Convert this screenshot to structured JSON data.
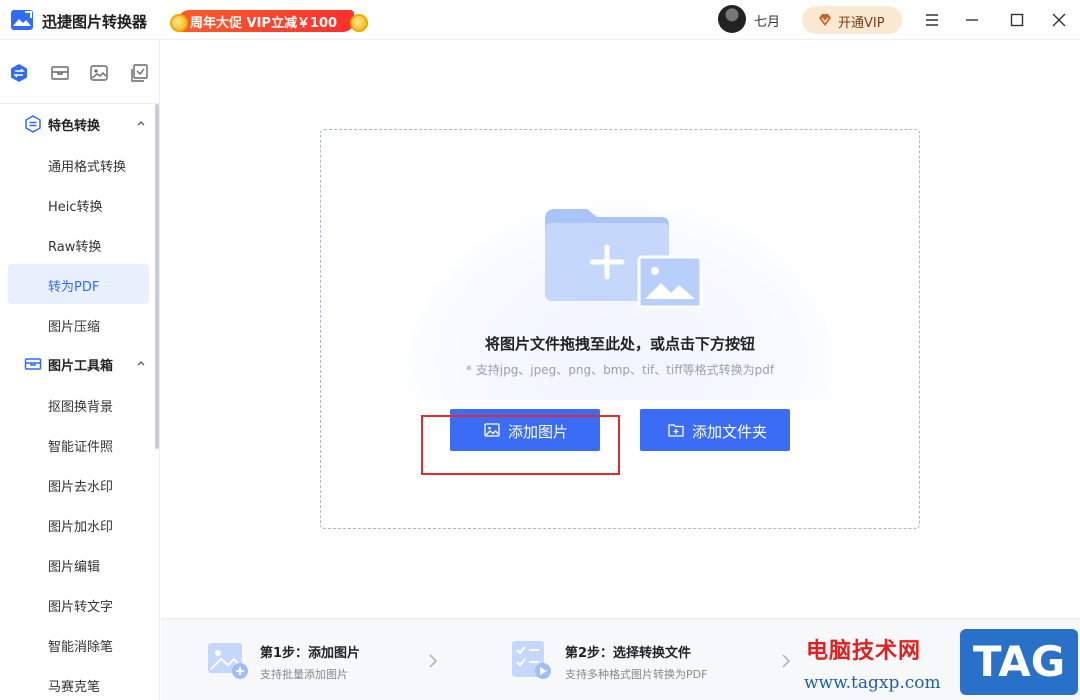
{
  "app": {
    "title": "迅捷图片转换器",
    "promo": "周年大促 VIP立减￥100",
    "username": "七月",
    "vip_button": "开通VIP"
  },
  "colors": {
    "accent": "#3b6cf6",
    "active_bg": "#e8f0fe",
    "highlight": "#e42b2b",
    "promo": "#ff3b2f"
  },
  "sidebar": {
    "tabs": [
      "convert-icon",
      "toolbox-icon",
      "image-icon",
      "check-icon"
    ],
    "groups": [
      {
        "label": "特色转换",
        "items": [
          "通用格式转换",
          "Heic转换",
          "Raw转换",
          "转为PDF",
          "图片压缩"
        ]
      },
      {
        "label": "图片工具箱",
        "items": [
          "抠图换背景",
          "智能证件照",
          "图片去水印",
          "图片加水印",
          "图片编辑",
          "图片转文字",
          "智能消除笔",
          "马赛克笔"
        ]
      }
    ],
    "active_item": "转为PDF"
  },
  "dropzone": {
    "title": "将图片文件拖拽至此处，或点击下方按钮",
    "hint": "* 支持jpg、jpeg、png、bmp、tif、tiff等格式转换为pdf",
    "add_image": "添加图片",
    "add_folder": "添加文件夹"
  },
  "steps": [
    {
      "title": "第1步：添加图片",
      "sub": "支持批量添加图片"
    },
    {
      "title": "第2步：选择转换文件",
      "sub": "支持多种格式图片转换为PDF"
    }
  ],
  "watermark": {
    "cn": "电脑技术网",
    "url": "www.tagxp.com",
    "tag": "TAG"
  }
}
